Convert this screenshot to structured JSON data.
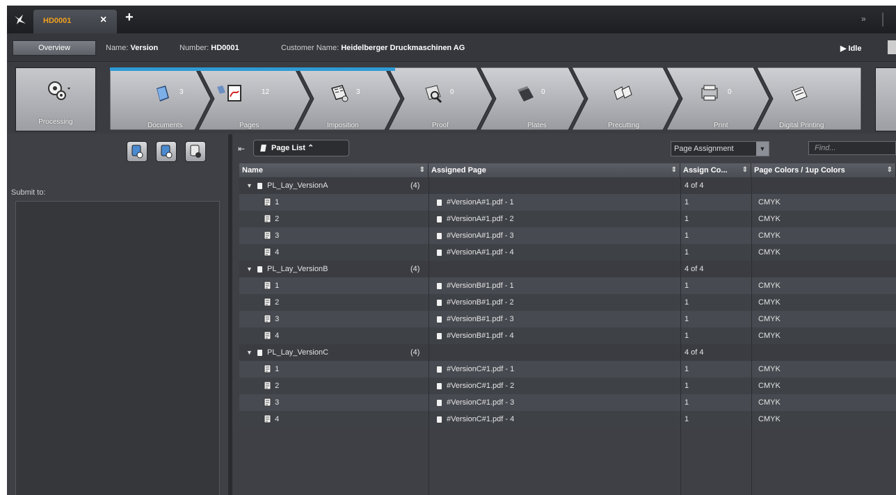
{
  "tabs": {
    "active_title": "HD0001",
    "close_label": "×",
    "add_label": "+",
    "menu_label": "»"
  },
  "info": {
    "overview_label": "Overview",
    "name_label": "Name:",
    "name_value": "Version",
    "number_label": "Number:",
    "number_value": "HD0001",
    "customer_label": "Customer Name:",
    "customer_value": "Heidelberger Druckmaschinen AG",
    "status": "▶ Idle"
  },
  "workflow": {
    "processing_label": "Processing",
    "steps": [
      {
        "label": "Documents",
        "count": "3"
      },
      {
        "label": "Pages",
        "count": "12"
      },
      {
        "label": "Imposition",
        "count": "3"
      },
      {
        "label": "Proof",
        "count": "0"
      },
      {
        "label": "Plates",
        "count": "0"
      },
      {
        "label": "Precutting",
        "count": ""
      },
      {
        "label": "Print",
        "count": "0"
      },
      {
        "label": "Digital Printing",
        "count": ""
      }
    ],
    "progress_steps": 3
  },
  "left_panel": {
    "submit_label": "Submit to:"
  },
  "toolbar": {
    "page_list_label": "Page List ⌃",
    "assign_select_value": "Page Assignment",
    "find_placeholder": "Find..."
  },
  "table": {
    "columns": [
      "Name",
      "Assigned Page",
      "Assign Co...",
      "Page Colors / 1up Colors"
    ],
    "groups": [
      {
        "name": "PL_Lay_VersionA",
        "count": "(4)",
        "assign": "4 of 4",
        "rows": [
          {
            "name": "1",
            "page": "#VersionA#1.pdf - 1",
            "assign": "1",
            "colors": "CMYK"
          },
          {
            "name": "2",
            "page": "#VersionA#1.pdf - 2",
            "assign": "1",
            "colors": "CMYK"
          },
          {
            "name": "3",
            "page": "#VersionA#1.pdf - 3",
            "assign": "1",
            "colors": "CMYK"
          },
          {
            "name": "4",
            "page": "#VersionA#1.pdf - 4",
            "assign": "1",
            "colors": "CMYK"
          }
        ]
      },
      {
        "name": "PL_Lay_VersionB",
        "count": "(4)",
        "assign": "4 of 4",
        "rows": [
          {
            "name": "1",
            "page": "#VersionB#1.pdf - 1",
            "assign": "1",
            "colors": "CMYK"
          },
          {
            "name": "2",
            "page": "#VersionB#1.pdf - 2",
            "assign": "1",
            "colors": "CMYK"
          },
          {
            "name": "3",
            "page": "#VersionB#1.pdf - 3",
            "assign": "1",
            "colors": "CMYK"
          },
          {
            "name": "4",
            "page": "#VersionB#1.pdf - 4",
            "assign": "1",
            "colors": "CMYK"
          }
        ]
      },
      {
        "name": "PL_Lay_VersionC",
        "count": "(4)",
        "assign": "4 of 4",
        "rows": [
          {
            "name": "1",
            "page": "#VersionC#1.pdf - 1",
            "assign": "1",
            "colors": "CMYK"
          },
          {
            "name": "2",
            "page": "#VersionC#1.pdf - 2",
            "assign": "1",
            "colors": "CMYK"
          },
          {
            "name": "3",
            "page": "#VersionC#1.pdf - 3",
            "assign": "1",
            "colors": "CMYK"
          },
          {
            "name": "4",
            "page": "#VersionC#1.pdf - 4",
            "assign": "1",
            "colors": "CMYK"
          }
        ]
      }
    ]
  },
  "colors": {
    "accent": "#f0a01e",
    "progress": "#2f9bd6"
  }
}
